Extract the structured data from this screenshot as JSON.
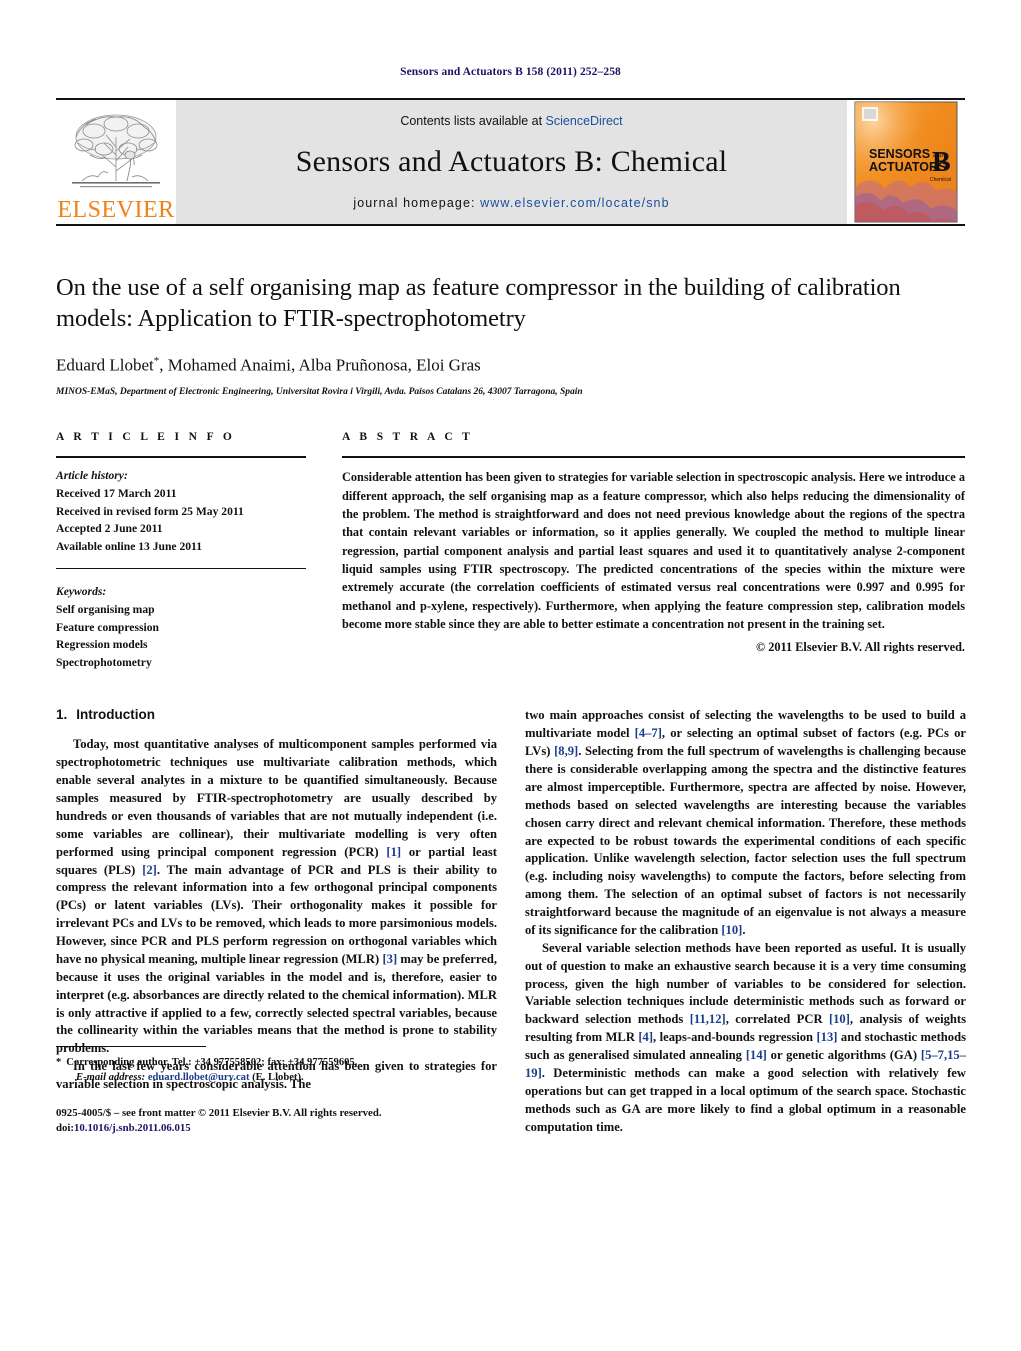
{
  "running_head": "Sensors and Actuators B 158 (2011) 252–258",
  "masthead": {
    "contents_prefix": "Contents lists available at ",
    "contents_link": "ScienceDirect",
    "journal_name": "Sensors and Actuators B: Chemical",
    "homepage_prefix": "journal homepage:",
    "homepage_url": "www.elsevier.com/locate/snb",
    "elsevier_wordmark": "ELSEVIER",
    "elsevier_orange": "#f08019",
    "link_blue": "#1a4f9c",
    "band_gray": "#e3e3e3",
    "cover": {
      "line1": "SENSORS",
      "line1_small": "and",
      "line2": "ACTUATORS",
      "letter": "B",
      "sub": "Chemical",
      "accent": "#ef8022"
    }
  },
  "title_block": {
    "title": "On the use of a self organising map as feature compressor in the building of calibration models: Application to FTIR-spectrophotometry",
    "authors": "Eduard Llobet",
    "authors_rest": ", Mohamed Anaimi, Alba Pruñonosa, Eloi Gras",
    "corresponding_mark": "*",
    "affiliation": "MINOS-EMaS, Department of Electronic Engineering, Universitat Rovira i Virgili, Avda. Paisos Catalans 26, 43007 Tarragona, Spain"
  },
  "article_info": {
    "label": "A R T I C L E   I N F O",
    "history_heading": "Article history:",
    "history": [
      "Received 17 March 2011",
      "Received in revised form 25 May 2011",
      "Accepted 2 June 2011",
      "Available online 13 June 2011"
    ],
    "keywords_heading": "Keywords:",
    "keywords": [
      "Self organising map",
      "Feature compression",
      "Regression models",
      "Spectrophotometry"
    ]
  },
  "abstract": {
    "label": "A B S T R A C T",
    "text": "Considerable attention has been given to strategies for variable selection in spectroscopic analysis. Here we introduce a different approach, the self organising map as a feature compressor, which also helps reducing the dimensionality of the problem. The method is straightforward and does not need previous knowledge about the regions of the spectra that contain relevant variables or information, so it applies generally. We coupled the method to multiple linear regression, partial component analysis and partial least squares and used it to quantitatively analyse 2-component liquid samples using FTIR spectroscopy. The predicted concentrations of the species within the mixture were extremely accurate (the correlation coefficients of estimated versus real concentrations were 0.997 and 0.995 for methanol and p-xylene, respectively). Furthermore, when applying the feature compression step, calibration models become more stable since they are able to better estimate a concentration not present in the training set.",
    "copyright": "© 2011 Elsevier B.V. All rights reserved."
  },
  "body": {
    "section1_num": "1.",
    "section1_title": "Introduction",
    "left_paragraphs": [
      "Today, most quantitative analyses of multicomponent samples performed via spectrophotometric techniques use multivariate calibration methods, which enable several analytes in a mixture to be quantified simultaneously. Because samples measured by FTIR-spectrophotometry are usually described by hundreds or even thousands of variables that are not mutually independent (i.e. some variables are collinear), their multivariate modelling is very often performed using principal component regression (PCR) [1] or partial least squares (PLS) [2]. The main advantage of PCR and PLS is their ability to compress the relevant information into a few orthogonal principal components (PCs) or latent variables (LVs). Their orthogonality makes it possible for irrelevant PCs and LVs to be removed, which leads to more parsimonious models. However, since PCR and PLS perform regression on orthogonal variables which have no physical meaning, multiple linear regression (MLR) [3] may be preferred, because it uses the original variables in the model and is, therefore, easier to interpret (e.g. absorbances are directly related to the chemical information). MLR is only attractive if applied to a few, correctly selected spectral variables, because the collinearity within the variables means that the method is prone to stability problems.",
      "In the last few years considerable attention has been given to strategies for variable selection in spectroscopic analysis. The"
    ],
    "right_paragraphs": [
      "two main approaches consist of selecting the wavelengths to be used to build a multivariate model [4–7], or selecting an optimal subset of factors (e.g. PCs or LVs) [8,9]. Selecting from the full spectrum of wavelengths is challenging because there is considerable overlapping among the spectra and the distinctive features are almost imperceptible. Furthermore, spectra are affected by noise. However, methods based on selected wavelengths are interesting because the variables chosen carry direct and relevant chemical information. Therefore, these methods are expected to be robust towards the experimental conditions of each specific application. Unlike wavelength selection, factor selection uses the full spectrum (e.g. including noisy wavelengths) to compute the factors, before selecting from among them. The selection of an optimal subset of factors is not necessarily straightforward because the magnitude of an eigenvalue is not always a measure of its significance for the calibration [10].",
      "Several variable selection methods have been reported as useful. It is usually out of question to make an exhaustive search because it is a very time consuming process, given the high number of variables to be considered for selection. Variable selection techniques include deterministic methods such as forward or backward selection methods [11,12], correlated PCR [10], analysis of weights resulting from MLR [4], leaps-and-bounds regression [13] and stochastic methods such as generalised simulated annealing [14] or genetic algorithms (GA) [5–7,15–19]. Deterministic methods can make a good selection with relatively few operations but can get trapped in a local optimum of the search space. Stochastic methods such as GA are more likely to find a global optimum in a reasonable computation time."
    ]
  },
  "footnotes": {
    "corresponding": "Corresponding author. Tel.: +34 977558502; fax: +34 977559605.",
    "email_label": "E-mail address:",
    "email": "eduard.llobet@urv.cat",
    "email_suffix": "(E. Llobet).",
    "issn_line": "0925-4005/$ – see front matter © 2011 Elsevier B.V. All rights reserved.",
    "doi_label": "doi:",
    "doi": "10.1016/j.snb.2011.06.015"
  }
}
